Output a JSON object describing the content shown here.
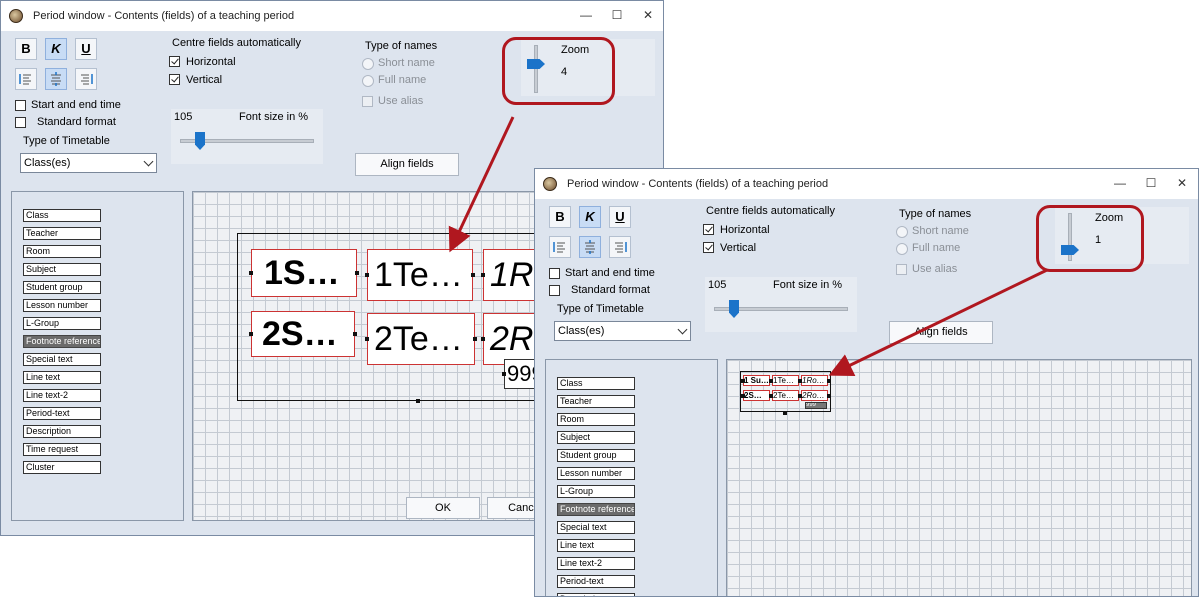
{
  "window": {
    "title": "Period window - Contents (fields) of a teaching period",
    "controls": {
      "minimize": "—",
      "maximize": "☐",
      "close": "✕"
    }
  },
  "toolbar": {
    "bold": "B",
    "italic": "K",
    "underline": "U"
  },
  "checkboxes": {
    "start_end_time": "Start and end time",
    "standard_format": "Standard format"
  },
  "centre": {
    "label": "Centre fields automatically",
    "horizontal": "Horizontal",
    "vertical": "Vertical",
    "horizontal_checked": true,
    "vertical_checked": true
  },
  "names": {
    "label": "Type of names",
    "short": "Short name",
    "full": "Full name",
    "use_alias": "Use alias"
  },
  "timetable": {
    "label": "Type of Timetable",
    "selected": "Class(es)"
  },
  "font": {
    "value": "105",
    "label": "Font size in %"
  },
  "zoom_label": "Zoom",
  "left_window": {
    "zoom_value": "4"
  },
  "right_window": {
    "zoom_value": "1"
  },
  "align_button": "Align fields",
  "ok_button": "OK",
  "cancel_button": "Cance",
  "fields": [
    "Class",
    "Teacher",
    "Room",
    "Subject",
    "Student group",
    "Lesson number",
    "L-Group",
    "Footnote reference",
    "Special text",
    "Line text",
    "Line text-2",
    "Period-text",
    "Description",
    "Time request",
    "Cluster"
  ],
  "selected_field": "Footnote reference",
  "preview_large": {
    "a1": "1S…",
    "a2": "1Te…",
    "a3": "1R",
    "b1": "2S…",
    "b2": "2Te…",
    "b3": "2R",
    "foot": "999"
  },
  "preview_small": {
    "a1": "1 Su…",
    "a2": "1Te…",
    "a3": "1Ro…",
    "b1": "2S…",
    "b2": "2Te…",
    "b3": "2Ro…",
    "foot": "999"
  },
  "colors": {
    "window_bg": "#dde4ee",
    "accent": "#1b73c9",
    "callout": "#b0171f",
    "field_border": "#cc3333"
  }
}
